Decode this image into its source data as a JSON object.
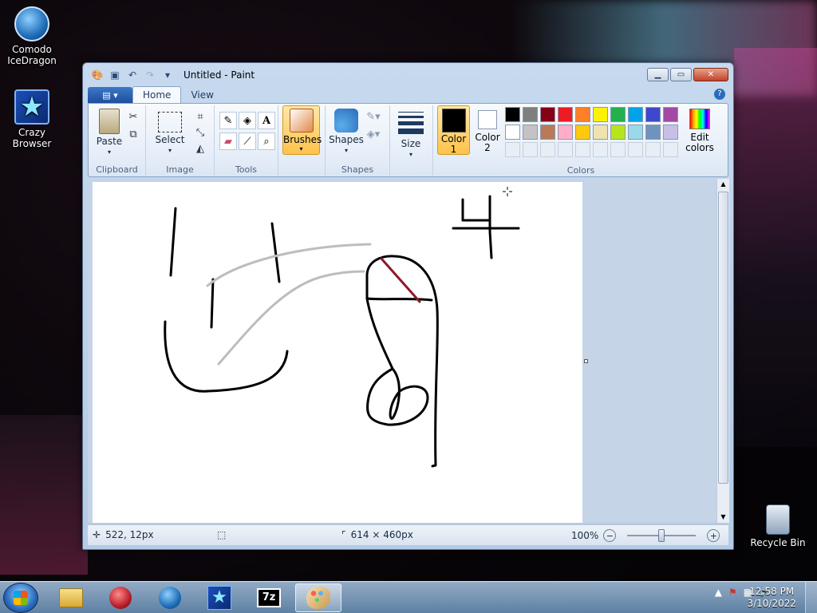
{
  "desktop": {
    "icons": [
      {
        "label": "Comodo IceDragon",
        "icon": "icedragon-icon"
      },
      {
        "label": "Crazy Browser",
        "icon": "crazy-browser-icon"
      },
      {
        "label": "Recycle Bin",
        "icon": "recycle-bin-icon"
      }
    ]
  },
  "window": {
    "title": "Untitled - Paint"
  },
  "ribbon": {
    "tabs": [
      {
        "label": "Home",
        "active": true
      },
      {
        "label": "View",
        "active": false
      }
    ],
    "groups": {
      "clipboard": {
        "label": "Clipboard",
        "paste": "Paste"
      },
      "image": {
        "label": "Image",
        "select": "Select"
      },
      "tools": {
        "label": "Tools"
      },
      "brushes": {
        "label": "Brushes"
      },
      "shapes": {
        "label": "Shapes",
        "button": "Shapes"
      },
      "size": {
        "label": "Size"
      },
      "colors": {
        "label": "Colors",
        "color1": "Color 1",
        "color1_line1": "Color",
        "color1_line2": "1",
        "color2_line1": "Color",
        "color2_line2": "2",
        "edit_colors_line1": "Edit",
        "edit_colors_line2": "colors",
        "color1_value": "#000000",
        "color2_value": "#ffffff",
        "palette_row1": [
          "#000000",
          "#7f7f7f",
          "#880015",
          "#ed1c24",
          "#ff7f27",
          "#fff200",
          "#22b14c",
          "#00a2e8",
          "#3f48cc",
          "#a349a4"
        ],
        "palette_row2": [
          "#ffffff",
          "#c3c3c3",
          "#b97a57",
          "#ffaec9",
          "#ffc90e",
          "#efe4b0",
          "#b5e61d",
          "#99d9ea",
          "#7092be",
          "#c8bfe7"
        ]
      }
    }
  },
  "statusbar": {
    "cursor_position": "522, 12px",
    "canvas_size": "614 × 460px",
    "zoom": "100%",
    "zoom_fraction": 0.5
  },
  "taskbar": {
    "clock_time": "12:58 PM",
    "clock_date": "3/10/2022",
    "pinned": [
      "explorer-icon",
      "icedragon-icon",
      "crazy-browser-icon",
      "7zip-icon",
      "paint-icon"
    ],
    "active": "paint-icon",
    "seven_zip_label": "7z"
  }
}
